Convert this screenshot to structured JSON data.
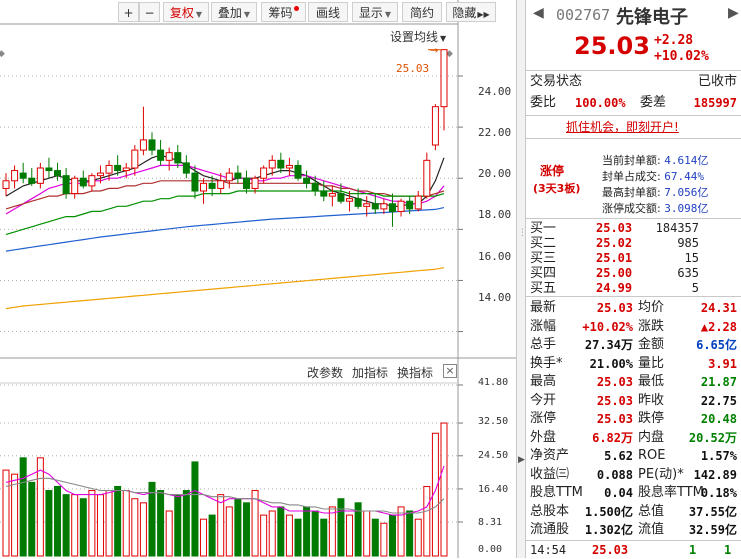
{
  "toolbar": {
    "buttons": [
      {
        "label": "+",
        "kind": "zoom-in"
      },
      {
        "label": "−",
        "kind": "zoom-out"
      },
      {
        "label": "复权",
        "selected": true,
        "dropdown": true
      },
      {
        "label": "叠加",
        "dropdown": true
      },
      {
        "label": "筹码",
        "badge": true
      },
      {
        "label": "画线"
      },
      {
        "label": "显示",
        "dropdown": true
      },
      {
        "label": "简约"
      },
      {
        "label": "隐藏",
        "more": "▶▶"
      }
    ]
  },
  "kline": {
    "settings_label": "设置均线",
    "price_tag": "25.03",
    "y_ticks": [
      "24.00",
      "22.00",
      "20.00",
      "18.00",
      "16.00",
      "14.00"
    ]
  },
  "volume": {
    "tools": [
      "改参数",
      "加指标",
      "换指标"
    ],
    "close_label": "×",
    "y_ticks": [
      "41.80",
      "32.50",
      "24.50",
      "16.40",
      "8.31",
      "0.00"
    ]
  },
  "quote": {
    "code": "002767",
    "name": "先锋电子",
    "price": "25.03",
    "change": "+2.28",
    "change_pct": "+10.02%",
    "trade_status_label": "交易状态",
    "trade_status_value": "已收市",
    "weibi_label": "委比",
    "weibi_value": "100.00%",
    "weicha_label": "委差",
    "weicha_value": "185997",
    "promo": "抓住机会，即刻开户!",
    "limit_title": "涨停",
    "limit_sub": "(3天3板)",
    "limit_stats": [
      {
        "label": "当前封单额:",
        "value": "4.614亿"
      },
      {
        "label": "封单占成交:",
        "value": "67.44%"
      },
      {
        "label": "最高封单额:",
        "value": "7.056亿"
      },
      {
        "label": "涨停成交额:",
        "value": "3.098亿"
      }
    ],
    "bids": [
      {
        "label": "买一",
        "price": "25.03",
        "vol": "184357"
      },
      {
        "label": "买二",
        "price": "25.02",
        "vol": "985"
      },
      {
        "label": "买三",
        "price": "25.01",
        "vol": "15"
      },
      {
        "label": "买四",
        "price": "25.00",
        "vol": "635"
      },
      {
        "label": "买五",
        "price": "24.99",
        "vol": "5"
      }
    ],
    "stats": [
      {
        "l1": "最新",
        "v1": "25.03",
        "c1": "red",
        "l2": "均价",
        "v2": "24.31",
        "c2": "red"
      },
      {
        "l1": "涨幅",
        "v1": "+10.02%",
        "c1": "red",
        "l2": "涨跌",
        "v2": "▲2.28",
        "c2": "red"
      },
      {
        "l1": "总手",
        "v1": "27.34万",
        "c1": "black",
        "l2": "金额",
        "v2": "6.65亿",
        "c2": "blue"
      },
      {
        "l1": "换手*",
        "v1": "21.00%",
        "c1": "black",
        "l2": "量比",
        "v2": "3.91",
        "c2": "red"
      },
      {
        "l1": "最高",
        "v1": "25.03",
        "c1": "red",
        "l2": "最低",
        "v2": "21.87",
        "c2": "green"
      },
      {
        "l1": "今开",
        "v1": "25.03",
        "c1": "red",
        "l2": "昨收",
        "v2": "22.75",
        "c2": "black"
      },
      {
        "l1": "涨停",
        "v1": "25.03",
        "c1": "red",
        "l2": "跌停",
        "v2": "20.48",
        "c2": "green"
      },
      {
        "l1": "外盘",
        "v1": "6.82万",
        "c1": "red",
        "l2": "内盘",
        "v2": "20.52万",
        "c2": "green"
      },
      {
        "l1": "净资产",
        "v1": "5.62",
        "c1": "black",
        "l2": "ROE",
        "v2": "1.57%",
        "c2": "black"
      },
      {
        "l1": "收益㈢",
        "v1": "0.088",
        "c1": "black",
        "l2": "PE(动)*",
        "v2": "142.89",
        "c2": "black"
      },
      {
        "l1": "股息TTM",
        "v1": "0.04",
        "c1": "black",
        "l2": "股息率TTM",
        "v2": "0.18%",
        "c2": "black"
      },
      {
        "l1": "总股本",
        "v1": "1.500亿",
        "c1": "black",
        "l2": "总值",
        "v2": "37.55亿",
        "c2": "black"
      },
      {
        "l1": "流通股",
        "v1": "1.302亿",
        "c1": "black",
        "l2": "流值",
        "v2": "32.59亿",
        "c2": "black"
      }
    ],
    "tick": {
      "time": "14:54",
      "price": "25.03",
      "vol": "1",
      "num": "1"
    }
  },
  "chart_data": {
    "type": "candlestick",
    "price_range": [
      13.2,
      25.8
    ],
    "candles": [
      {
        "o": 19.6,
        "h": 20.2,
        "l": 19.3,
        "c": 19.9
      },
      {
        "o": 19.9,
        "h": 20.5,
        "l": 19.6,
        "c": 20.3
      },
      {
        "o": 20.2,
        "h": 20.6,
        "l": 19.8,
        "c": 20.0
      },
      {
        "o": 20.0,
        "h": 20.4,
        "l": 19.7,
        "c": 19.8
      },
      {
        "o": 19.8,
        "h": 20.6,
        "l": 19.6,
        "c": 20.4
      },
      {
        "o": 20.4,
        "h": 20.8,
        "l": 20.0,
        "c": 20.3
      },
      {
        "o": 20.3,
        "h": 20.6,
        "l": 19.9,
        "c": 20.1
      },
      {
        "o": 20.1,
        "h": 20.4,
        "l": 19.2,
        "c": 19.4
      },
      {
        "o": 19.4,
        "h": 20.1,
        "l": 19.2,
        "c": 20.0
      },
      {
        "o": 20.0,
        "h": 20.3,
        "l": 19.6,
        "c": 19.7
      },
      {
        "o": 19.7,
        "h": 20.2,
        "l": 19.5,
        "c": 20.1
      },
      {
        "o": 20.1,
        "h": 20.5,
        "l": 19.8,
        "c": 20.2
      },
      {
        "o": 20.2,
        "h": 20.7,
        "l": 19.9,
        "c": 20.5
      },
      {
        "o": 20.5,
        "h": 20.9,
        "l": 20.1,
        "c": 20.3
      },
      {
        "o": 20.3,
        "h": 20.6,
        "l": 20.0,
        "c": 20.4
      },
      {
        "o": 20.4,
        "h": 21.3,
        "l": 20.1,
        "c": 21.1
      },
      {
        "o": 21.1,
        "h": 22.8,
        "l": 20.9,
        "c": 21.5
      },
      {
        "o": 21.5,
        "h": 21.8,
        "l": 20.9,
        "c": 21.1
      },
      {
        "o": 21.1,
        "h": 21.5,
        "l": 20.5,
        "c": 20.7
      },
      {
        "o": 20.7,
        "h": 21.2,
        "l": 20.3,
        "c": 21.0
      },
      {
        "o": 21.0,
        "h": 21.3,
        "l": 20.4,
        "c": 20.6
      },
      {
        "o": 20.6,
        "h": 20.9,
        "l": 20.0,
        "c": 20.2
      },
      {
        "o": 20.2,
        "h": 20.5,
        "l": 19.2,
        "c": 19.5
      },
      {
        "o": 19.5,
        "h": 20.0,
        "l": 19.0,
        "c": 19.8
      },
      {
        "o": 19.8,
        "h": 20.1,
        "l": 19.3,
        "c": 19.6
      },
      {
        "o": 19.6,
        "h": 20.2,
        "l": 19.4,
        "c": 19.9
      },
      {
        "o": 19.9,
        "h": 20.4,
        "l": 19.6,
        "c": 20.2
      },
      {
        "o": 20.2,
        "h": 20.5,
        "l": 19.8,
        "c": 20.0
      },
      {
        "o": 20.0,
        "h": 20.3,
        "l": 19.4,
        "c": 19.6
      },
      {
        "o": 19.6,
        "h": 20.1,
        "l": 19.4,
        "c": 20.0
      },
      {
        "o": 20.0,
        "h": 20.5,
        "l": 19.8,
        "c": 20.4
      },
      {
        "o": 20.4,
        "h": 20.9,
        "l": 20.1,
        "c": 20.7
      },
      {
        "o": 20.7,
        "h": 21.0,
        "l": 20.2,
        "c": 20.4
      },
      {
        "o": 20.4,
        "h": 20.8,
        "l": 20.1,
        "c": 20.5
      },
      {
        "o": 20.5,
        "h": 20.7,
        "l": 19.9,
        "c": 20.0
      },
      {
        "o": 20.0,
        "h": 20.3,
        "l": 19.6,
        "c": 19.8
      },
      {
        "o": 19.8,
        "h": 20.1,
        "l": 19.3,
        "c": 19.5
      },
      {
        "o": 19.5,
        "h": 19.9,
        "l": 19.1,
        "c": 19.3
      },
      {
        "o": 19.3,
        "h": 19.7,
        "l": 18.9,
        "c": 19.4
      },
      {
        "o": 19.4,
        "h": 19.8,
        "l": 19.0,
        "c": 19.1
      },
      {
        "o": 19.1,
        "h": 19.5,
        "l": 18.7,
        "c": 19.2
      },
      {
        "o": 19.2,
        "h": 19.6,
        "l": 18.8,
        "c": 18.9
      },
      {
        "o": 18.9,
        "h": 19.3,
        "l": 18.5,
        "c": 19.0
      },
      {
        "o": 19.0,
        "h": 19.4,
        "l": 18.6,
        "c": 18.8
      },
      {
        "o": 18.8,
        "h": 19.2,
        "l": 18.6,
        "c": 19.0
      },
      {
        "o": 19.0,
        "h": 19.4,
        "l": 18.1,
        "c": 18.7
      },
      {
        "o": 18.7,
        "h": 19.2,
        "l": 18.5,
        "c": 19.1
      },
      {
        "o": 19.1,
        "h": 19.3,
        "l": 18.6,
        "c": 18.8
      },
      {
        "o": 18.8,
        "h": 19.5,
        "l": 18.7,
        "c": 19.3
      },
      {
        "o": 19.3,
        "h": 21.0,
        "l": 19.2,
        "c": 20.7
      },
      {
        "o": 21.3,
        "h": 22.9,
        "l": 21.1,
        "c": 22.8
      },
      {
        "o": 22.8,
        "h": 25.03,
        "l": 21.87,
        "c": 25.03
      }
    ],
    "ma": [
      {
        "color": "#222222",
        "values": [
          19.3,
          19.5,
          19.7,
          19.8,
          19.9,
          20.0,
          20.1,
          20.0,
          19.9,
          19.9,
          19.9,
          20.0,
          20.1,
          20.2,
          20.3,
          20.4,
          20.6,
          20.8,
          20.9,
          20.8,
          20.7,
          20.5,
          20.3,
          20.1,
          20.0,
          19.9,
          19.9,
          20.0,
          20.0,
          20.0,
          20.1,
          20.2,
          20.3,
          20.3,
          20.2,
          20.1,
          19.9,
          19.7,
          19.5,
          19.4,
          19.3,
          19.2,
          19.1,
          19.0,
          19.0,
          18.9,
          18.9,
          19.0,
          19.0,
          19.3,
          19.9,
          20.8
        ]
      },
      {
        "color": "#e000e0",
        "values": [
          18.6,
          18.8,
          19.0,
          19.2,
          19.4,
          19.6,
          19.7,
          19.8,
          19.8,
          19.8,
          19.9,
          19.9,
          20.0,
          20.0,
          20.1,
          20.2,
          20.3,
          20.4,
          20.5,
          20.5,
          20.5,
          20.5,
          20.4,
          20.3,
          20.2,
          20.1,
          20.0,
          20.0,
          20.0,
          19.9,
          19.9,
          20.0,
          20.0,
          20.1,
          20.1,
          20.1,
          20.0,
          19.9,
          19.8,
          19.7,
          19.6,
          19.5,
          19.4,
          19.3,
          19.2,
          19.1,
          19.1,
          19.0,
          19.0,
          19.1,
          19.3,
          19.7
        ]
      },
      {
        "color": "#b03030",
        "values": [
          18.8,
          18.9,
          19.0,
          19.1,
          19.2,
          19.3,
          19.3,
          19.4,
          19.4,
          19.4,
          19.5,
          19.5,
          19.6,
          19.6,
          19.7,
          19.7,
          19.8,
          19.8,
          19.9,
          19.9,
          19.9,
          19.9,
          19.9,
          19.9,
          19.9,
          19.9,
          19.8,
          19.8,
          19.8,
          19.8,
          19.8,
          19.8,
          19.8,
          19.8,
          19.8,
          19.8,
          19.8,
          19.7,
          19.7,
          19.6,
          19.6,
          19.5,
          19.5,
          19.4,
          19.4,
          19.3,
          19.3,
          19.3,
          19.3,
          19.3,
          19.4,
          19.5
        ]
      },
      {
        "color": "#009000",
        "values": [
          17.8,
          17.9,
          18.0,
          18.1,
          18.2,
          18.3,
          18.4,
          18.5,
          18.5,
          18.6,
          18.7,
          18.7,
          18.8,
          18.9,
          18.9,
          19.0,
          19.1,
          19.1,
          19.2,
          19.2,
          19.3,
          19.3,
          19.3,
          19.4,
          19.4,
          19.4,
          19.4,
          19.5,
          19.5,
          19.5,
          19.5,
          19.5,
          19.5,
          19.5,
          19.5,
          19.5,
          19.5,
          19.5,
          19.5,
          19.5,
          19.4,
          19.4,
          19.4,
          19.4,
          19.3,
          19.3,
          19.3,
          19.3,
          19.3,
          19.3,
          19.3,
          19.4
        ]
      },
      {
        "color": "#2060d0",
        "values": [
          17.15,
          17.2,
          17.25,
          17.3,
          17.35,
          17.4,
          17.45,
          17.5,
          17.55,
          17.6,
          17.65,
          17.7,
          17.74,
          17.78,
          17.82,
          17.86,
          17.9,
          17.94,
          17.98,
          18.02,
          18.06,
          18.1,
          18.13,
          18.16,
          18.19,
          18.22,
          18.25,
          18.28,
          18.31,
          18.34,
          18.37,
          18.4,
          18.42,
          18.44,
          18.46,
          18.48,
          18.5,
          18.52,
          18.54,
          18.56,
          18.58,
          18.6,
          18.62,
          18.64,
          18.66,
          18.68,
          18.7,
          18.72,
          18.74,
          18.76,
          18.78,
          18.85
        ]
      },
      {
        "color": "#f0a000",
        "values": [
          14.9,
          14.95,
          15.0,
          15.03,
          15.06,
          15.09,
          15.12,
          15.15,
          15.18,
          15.21,
          15.24,
          15.27,
          15.3,
          15.33,
          15.36,
          15.39,
          15.42,
          15.45,
          15.48,
          15.51,
          15.54,
          15.57,
          15.6,
          15.63,
          15.66,
          15.69,
          15.72,
          15.75,
          15.78,
          15.81,
          15.84,
          15.87,
          15.9,
          15.93,
          15.96,
          15.99,
          16.02,
          16.05,
          16.08,
          16.11,
          16.14,
          16.17,
          16.2,
          16.23,
          16.26,
          16.29,
          16.32,
          16.35,
          16.38,
          16.41,
          16.44,
          16.5
        ]
      }
    ],
    "volume_range": [
      0,
      41.8
    ],
    "volumes": [
      21,
      20,
      24,
      18,
      24,
      16,
      17,
      15,
      15,
      14,
      16,
      15,
      16,
      17,
      16,
      14,
      13,
      18,
      16,
      11,
      15,
      16,
      23,
      9,
      10,
      15,
      12,
      14,
      13,
      16,
      10,
      11,
      12,
      10,
      9,
      12,
      11,
      9,
      12,
      14,
      10,
      13,
      11,
      9,
      8,
      10,
      12,
      11,
      9,
      17,
      30,
      32.5
    ],
    "vol_ma": [
      {
        "color": "#e000e0",
        "values": [
          18,
          18.5,
          19,
          20,
          21,
          20,
          18,
          16,
          15,
          15,
          15,
          15,
          15.5,
          16,
          16,
          15.5,
          15,
          15.5,
          15.5,
          15,
          14.5,
          15,
          16,
          15,
          14,
          13,
          14,
          14,
          14,
          14,
          13,
          12,
          12,
          11,
          11,
          11,
          11,
          10.5,
          10.5,
          11,
          11,
          11,
          11,
          11,
          10.5,
          10,
          10,
          10.5,
          11,
          12,
          16,
          22
        ]
      },
      {
        "color": "#888888",
        "values": [
          17,
          17.5,
          18,
          18.5,
          19,
          19,
          18.5,
          18,
          17.5,
          17,
          16.5,
          16,
          16,
          16,
          16,
          15.5,
          15.5,
          15.5,
          15.5,
          15,
          15,
          15,
          15,
          15,
          14.5,
          14.5,
          14.5,
          14,
          14,
          14,
          13.5,
          13,
          13,
          12.5,
          12.5,
          12,
          12,
          11.5,
          11.5,
          11.5,
          11.5,
          11,
          11,
          11,
          11,
          10.5,
          10.5,
          10.5,
          10.5,
          11,
          12,
          14
        ]
      }
    ]
  }
}
